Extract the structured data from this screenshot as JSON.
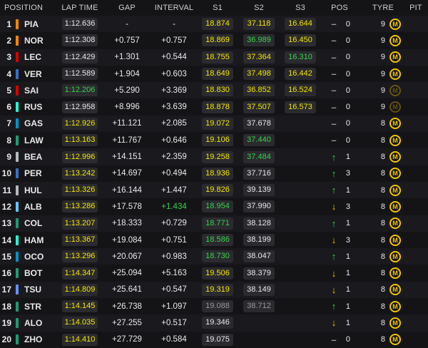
{
  "headers": {
    "position": "POSITION",
    "lap_time": "LAP TIME",
    "gap": "GAP",
    "interval": "INTERVAL",
    "s1": "S1",
    "s2": "S2",
    "s3": "S3",
    "pos": "POS",
    "tyre": "TYRE",
    "pit": "PIT"
  },
  "colors": {
    "purple_sector": "#f5e600",
    "personal_best": "#39d34a",
    "normal": "#e9e9e9",
    "soft_tyre": "#f2c400"
  },
  "rows": [
    {
      "pos": "1",
      "team_color": "#ff8700",
      "driver": "PIA",
      "lap": "1:12.636",
      "lap_c": "w",
      "gap": "-",
      "interval": "-",
      "int_c": "w",
      "s1": "18.874",
      "s1_c": "y",
      "s2": "37.118",
      "s2_c": "y",
      "s3": "16.644",
      "s3_c": "y",
      "dir": "–",
      "dir_c": "nc",
      "change": "0",
      "tyre_age": "9",
      "tyre": "M",
      "tyre_dim": false
    },
    {
      "pos": "2",
      "team_color": "#ff8700",
      "driver": "NOR",
      "lap": "1:12.308",
      "lap_c": "w",
      "gap": "+0.757",
      "interval": "+0.757",
      "int_c": "w",
      "s1": "18.869",
      "s1_c": "y",
      "s2": "36.989",
      "s2_c": "g",
      "s3": "16.450",
      "s3_c": "y",
      "dir": "–",
      "dir_c": "nc",
      "change": "0",
      "tyre_age": "9",
      "tyre": "M",
      "tyre_dim": false
    },
    {
      "pos": "3",
      "team_color": "#dc0000",
      "driver": "LEC",
      "lap": "1:12.429",
      "lap_c": "w",
      "gap": "+1.301",
      "interval": "+0.544",
      "int_c": "w",
      "s1": "18.755",
      "s1_c": "y",
      "s2": "37.364",
      "s2_c": "y",
      "s3": "16.310",
      "s3_c": "g",
      "dir": "–",
      "dir_c": "nc",
      "change": "0",
      "tyre_age": "9",
      "tyre": "M",
      "tyre_dim": false
    },
    {
      "pos": "4",
      "team_color": "#3671c6",
      "driver": "VER",
      "lap": "1:12.589",
      "lap_c": "w",
      "gap": "+1.904",
      "interval": "+0.603",
      "int_c": "w",
      "s1": "18.649",
      "s1_c": "y",
      "s2": "37.498",
      "s2_c": "y",
      "s3": "16.442",
      "s3_c": "y",
      "dir": "–",
      "dir_c": "nc",
      "change": "0",
      "tyre_age": "9",
      "tyre": "M",
      "tyre_dim": false
    },
    {
      "pos": "5",
      "team_color": "#dc0000",
      "driver": "SAI",
      "lap": "1:12.206",
      "lap_c": "g",
      "gap": "+5.290",
      "interval": "+3.369",
      "int_c": "w",
      "s1": "18.830",
      "s1_c": "y",
      "s2": "36.852",
      "s2_c": "y",
      "s3": "16.524",
      "s3_c": "y",
      "dir": "–",
      "dir_c": "nc",
      "change": "0",
      "tyre_age": "9",
      "tyre": "M",
      "tyre_dim": true
    },
    {
      "pos": "6",
      "team_color": "#27f4d2",
      "driver": "RUS",
      "lap": "1:12.958",
      "lap_c": "w",
      "gap": "+8.996",
      "interval": "+3.639",
      "int_c": "w",
      "s1": "18.878",
      "s1_c": "y",
      "s2": "37.507",
      "s2_c": "y",
      "s3": "16.573",
      "s3_c": "y",
      "dir": "–",
      "dir_c": "nc",
      "change": "0",
      "tyre_age": "9",
      "tyre": "M",
      "tyre_dim": true
    },
    {
      "pos": "7",
      "team_color": "#0093cc",
      "driver": "GAS",
      "lap": "1:12.926",
      "lap_c": "y",
      "gap": "+11.121",
      "interval": "+2.085",
      "int_c": "w",
      "s1": "19.072",
      "s1_c": "y",
      "s2": "37.678",
      "s2_c": "w",
      "s3": "",
      "s3_c": "w",
      "dir": "–",
      "dir_c": "nc",
      "change": "0",
      "tyre_age": "8",
      "tyre": "M",
      "tyre_dim": false
    },
    {
      "pos": "8",
      "team_color": "#229971",
      "driver": "LAW",
      "lap": "1:13.163",
      "lap_c": "y",
      "gap": "+11.767",
      "interval": "+0.646",
      "int_c": "w",
      "s1": "19.106",
      "s1_c": "y",
      "s2": "37.440",
      "s2_c": "g",
      "s3": "",
      "s3_c": "w",
      "dir": "–",
      "dir_c": "nc",
      "change": "0",
      "tyre_age": "8",
      "tyre": "M",
      "tyre_dim": false
    },
    {
      "pos": "9",
      "team_color": "#b6babd",
      "driver": "BEA",
      "lap": "1:12.996",
      "lap_c": "y",
      "gap": "+14.151",
      "interval": "+2.359",
      "int_c": "w",
      "s1": "19.258",
      "s1_c": "y",
      "s2": "37.484",
      "s2_c": "g",
      "s3": "",
      "s3_c": "w",
      "dir": "↑",
      "dir_c": "up",
      "change": "1",
      "tyre_age": "8",
      "tyre": "M",
      "tyre_dim": false
    },
    {
      "pos": "10",
      "team_color": "#3671c6",
      "driver": "PER",
      "lap": "1:13.242",
      "lap_c": "y",
      "gap": "+14.697",
      "interval": "+0.494",
      "int_c": "w",
      "s1": "18.936",
      "s1_c": "y",
      "s2": "37.716",
      "s2_c": "w",
      "s3": "",
      "s3_c": "w",
      "dir": "↑",
      "dir_c": "up",
      "change": "3",
      "tyre_age": "8",
      "tyre": "M",
      "tyre_dim": false
    },
    {
      "pos": "11",
      "team_color": "#b6babd",
      "driver": "HUL",
      "lap": "1:13.326",
      "lap_c": "y",
      "gap": "+16.144",
      "interval": "+1.447",
      "int_c": "w",
      "s1": "19.826",
      "s1_c": "y",
      "s2": "39.139",
      "s2_c": "w",
      "s3": "",
      "s3_c": "w",
      "dir": "↑",
      "dir_c": "up",
      "change": "1",
      "tyre_age": "8",
      "tyre": "M",
      "tyre_dim": false
    },
    {
      "pos": "12",
      "team_color": "#64c4ff",
      "driver": "ALB",
      "lap": "1:13.286",
      "lap_c": "y",
      "gap": "+17.578",
      "interval": "+1.434",
      "int_c": "g",
      "s1": "18.954",
      "s1_c": "g",
      "s2": "37.990",
      "s2_c": "w",
      "s3": "",
      "s3_c": "w",
      "dir": "↓",
      "dir_c": "dn",
      "change": "3",
      "tyre_age": "8",
      "tyre": "M",
      "tyre_dim": false
    },
    {
      "pos": "13",
      "team_color": "#229971",
      "driver": "COL",
      "lap": "1:13.207",
      "lap_c": "y",
      "gap": "+18.333",
      "interval": "+0.729",
      "int_c": "w",
      "s1": "18.771",
      "s1_c": "g",
      "s2": "38.128",
      "s2_c": "w",
      "s3": "",
      "s3_c": "w",
      "dir": "↑",
      "dir_c": "up",
      "change": "1",
      "tyre_age": "8",
      "tyre": "M",
      "tyre_dim": false
    },
    {
      "pos": "14",
      "team_color": "#27f4d2",
      "driver": "HAM",
      "lap": "1:13.367",
      "lap_c": "y",
      "gap": "+19.084",
      "interval": "+0.751",
      "int_c": "w",
      "s1": "18.586",
      "s1_c": "g",
      "s2": "38.199",
      "s2_c": "w",
      "s3": "",
      "s3_c": "w",
      "dir": "↓",
      "dir_c": "dn",
      "change": "3",
      "tyre_age": "8",
      "tyre": "M",
      "tyre_dim": false
    },
    {
      "pos": "15",
      "team_color": "#0093cc",
      "driver": "OCO",
      "lap": "1:13.296",
      "lap_c": "y",
      "gap": "+20.067",
      "interval": "+0.983",
      "int_c": "w",
      "s1": "18.730",
      "s1_c": "g",
      "s2": "38.047",
      "s2_c": "w",
      "s3": "",
      "s3_c": "w",
      "dir": "↑",
      "dir_c": "up",
      "change": "1",
      "tyre_age": "8",
      "tyre": "M",
      "tyre_dim": false
    },
    {
      "pos": "16",
      "team_color": "#229971",
      "driver": "BOT",
      "lap": "1:14.347",
      "lap_c": "y",
      "gap": "+25.094",
      "interval": "+5.163",
      "int_c": "w",
      "s1": "19.506",
      "s1_c": "y",
      "s2": "38.379",
      "s2_c": "w",
      "s3": "",
      "s3_c": "w",
      "dir": "↓",
      "dir_c": "dn",
      "change": "1",
      "tyre_age": "8",
      "tyre": "M",
      "tyre_dim": false
    },
    {
      "pos": "17",
      "team_color": "#6692ff",
      "driver": "TSU",
      "lap": "1:14.809",
      "lap_c": "y",
      "gap": "+25.641",
      "interval": "+0.547",
      "int_c": "w",
      "s1": "19.319",
      "s1_c": "y",
      "s2": "38.149",
      "s2_c": "w",
      "s3": "",
      "s3_c": "w",
      "dir": "↓",
      "dir_c": "dn",
      "change": "1",
      "tyre_age": "8",
      "tyre": "M",
      "tyre_dim": false
    },
    {
      "pos": "18",
      "team_color": "#229971",
      "driver": "STR",
      "lap": "1:14.145",
      "lap_c": "y",
      "gap": "+26.738",
      "interval": "+1.097",
      "int_c": "w",
      "s1": "19.088",
      "s1_c": "gy",
      "s2": "38.712",
      "s2_c": "gy",
      "s3": "",
      "s3_c": "w",
      "dir": "↑",
      "dir_c": "up",
      "change": "1",
      "tyre_age": "8",
      "tyre": "M",
      "tyre_dim": false
    },
    {
      "pos": "19",
      "team_color": "#229971",
      "driver": "ALO",
      "lap": "1:14.035",
      "lap_c": "y",
      "gap": "+27.255",
      "interval": "+0.517",
      "int_c": "w",
      "s1": "19.346",
      "s1_c": "w",
      "s2": "",
      "s2_c": "w",
      "s3": "",
      "s3_c": "w",
      "dir": "↓",
      "dir_c": "dn",
      "change": "1",
      "tyre_age": "8",
      "tyre": "M",
      "tyre_dim": false
    },
    {
      "pos": "20",
      "team_color": "#229971",
      "driver": "ZHO",
      "lap": "1:14.410",
      "lap_c": "y",
      "gap": "+27.729",
      "interval": "+0.584",
      "int_c": "w",
      "s1": "19.075",
      "s1_c": "w",
      "s2": "",
      "s2_c": "w",
      "s3": "",
      "s3_c": "w",
      "dir": "–",
      "dir_c": "nc",
      "change": "0",
      "tyre_age": "8",
      "tyre": "M",
      "tyre_dim": false
    }
  ]
}
